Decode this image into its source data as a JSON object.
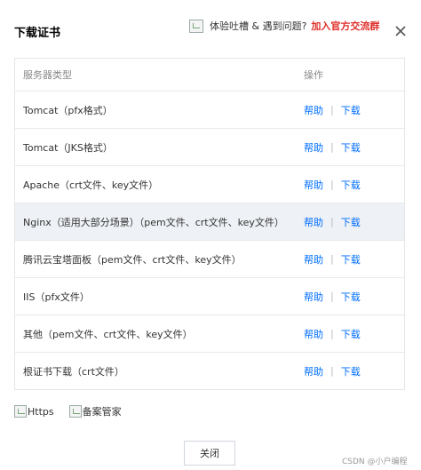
{
  "dialog": {
    "title": "下载证书",
    "feedback_text": "体验吐槽 & 遇到问题?",
    "feedback_link": "加入官方交流群",
    "close_button": "关闭"
  },
  "table": {
    "headers": {
      "name": "服务器类型",
      "ops": "操作"
    },
    "rows": [
      {
        "name": "Tomcat（pfx格式）",
        "help": "帮助",
        "download": "下载"
      },
      {
        "name": "Tomcat（JKS格式）",
        "help": "帮助",
        "download": "下载"
      },
      {
        "name": "Apache（crt文件、key文件）",
        "help": "帮助",
        "download": "下载"
      },
      {
        "name": "Nginx（适用大部分场景）（pem文件、crt文件、key文件）",
        "help": "帮助",
        "download": "下载"
      },
      {
        "name": "腾讯云宝塔面板（pem文件、crt文件、key文件）",
        "help": "帮助",
        "download": "下载"
      },
      {
        "name": "IIS（pfx文件）",
        "help": "帮助",
        "download": "下载"
      },
      {
        "name": "其他（pem文件、crt文件、key文件）",
        "help": "帮助",
        "download": "下载"
      },
      {
        "name": "根证书下载（crt文件）",
        "help": "帮助",
        "download": "下载"
      }
    ],
    "separator": "|"
  },
  "footer": {
    "https_label": "Https",
    "beian_label": "备案管家"
  },
  "watermark": "CSDN @小户编程",
  "colors": {
    "link": "#006eff",
    "accent_red": "#e0302b",
    "hover_row": "#eef1f5"
  }
}
